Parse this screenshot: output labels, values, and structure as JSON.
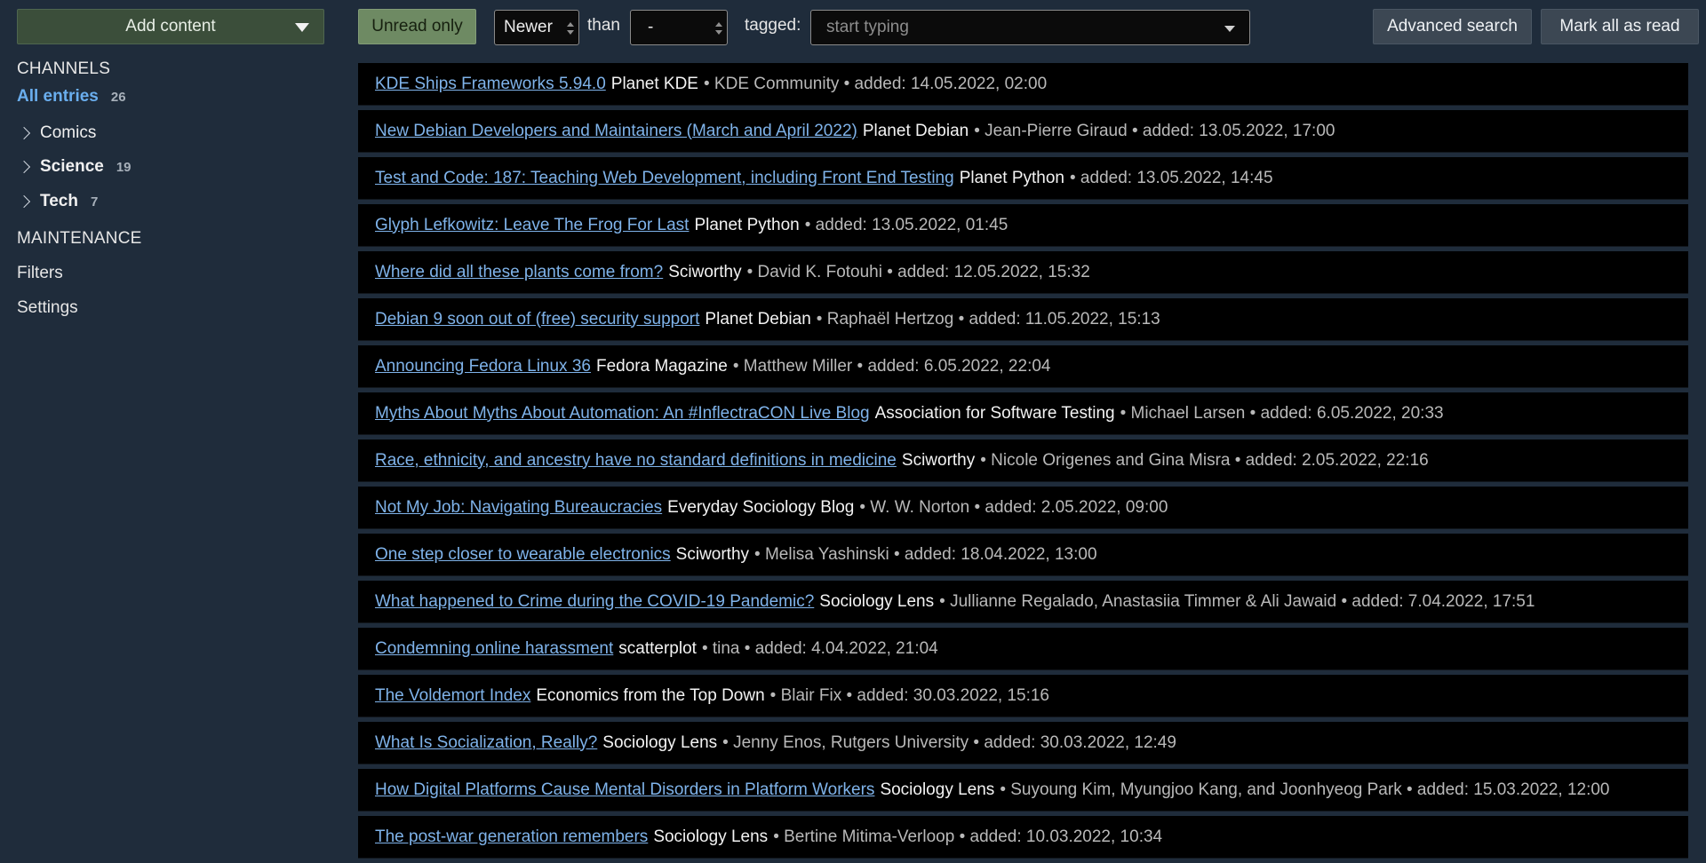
{
  "sidebar": {
    "add_content_label": "Add content",
    "channels_title": "CHANNELS",
    "all_entries": {
      "label": "All entries",
      "count": "26"
    },
    "tags": [
      {
        "label": "Comics",
        "count": "",
        "bold": false
      },
      {
        "label": "Science",
        "count": "19",
        "bold": true
      },
      {
        "label": "Tech",
        "count": "7",
        "bold": true
      }
    ],
    "maintenance_title": "MAINTENANCE",
    "filters_label": "Filters",
    "settings_label": "Settings"
  },
  "toolbar": {
    "unread_only_label": "Unread only",
    "newer_select_value": "Newer",
    "than_label": "than",
    "date_select_value": "-",
    "tagged_label": "tagged:",
    "tag_input_placeholder": "start typing",
    "advanced_search_label": "Advanced search",
    "mark_all_read_label": "Mark all as read"
  },
  "entries": [
    {
      "title": "KDE Ships Frameworks 5.94.0",
      "feed": "Planet KDE",
      "meta": "• KDE Community • added: 14.05.2022, 02:00"
    },
    {
      "title": "New Debian Developers and Maintainers (March and April 2022)",
      "feed": "Planet Debian",
      "meta": "• Jean-Pierre Giraud • added: 13.05.2022, 17:00"
    },
    {
      "title": "Test and Code: 187: Teaching Web Development, including Front End Testing",
      "feed": "Planet Python",
      "meta": "• added: 13.05.2022, 14:45"
    },
    {
      "title": "Glyph Lefkowitz: Leave The Frog For Last",
      "feed": "Planet Python",
      "meta": "• added: 13.05.2022, 01:45"
    },
    {
      "title": "Where did all these plants come from?",
      "feed": "Sciworthy",
      "meta": "• David K. Fotouhi • added: 12.05.2022, 15:32"
    },
    {
      "title": "Debian 9 soon out of (free) security support",
      "feed": "Planet Debian",
      "meta": "• Raphaël Hertzog • added: 11.05.2022, 15:13"
    },
    {
      "title": "Announcing Fedora Linux 36",
      "feed": "Fedora Magazine",
      "meta": "• Matthew Miller • added: 6.05.2022, 22:04"
    },
    {
      "title": "Myths About Myths About Automation: An #InflectraCON Live Blog",
      "feed": "Association for Software Testing",
      "meta": "• Michael Larsen • added: 6.05.2022, 20:33"
    },
    {
      "title": "Race, ethnicity, and ancestry have no standard definitions in medicine",
      "feed": "Sciworthy",
      "meta": "• Nicole Origenes and Gina Misra • added: 2.05.2022, 22:16"
    },
    {
      "title": "Not My Job: Navigating Bureaucracies",
      "feed": "Everyday Sociology Blog",
      "meta": "• W. W. Norton • added: 2.05.2022, 09:00"
    },
    {
      "title": "One step closer to wearable electronics",
      "feed": "Sciworthy",
      "meta": "• Melisa Yashinski • added: 18.04.2022, 13:00"
    },
    {
      "title": "What happened to Crime during the COVID-19 Pandemic?",
      "feed": "Sociology Lens",
      "meta": "• Jullianne Regalado, Anastasiia Timmer & Ali Jawaid • added: 7.04.2022, 17:51"
    },
    {
      "title": "Condemning online harassment",
      "feed": "scatterplot",
      "meta": "• tina • added: 4.04.2022, 21:04"
    },
    {
      "title": "The Voldemort Index",
      "feed": "Economics from the Top Down",
      "meta": "• Blair Fix • added: 30.03.2022, 15:16"
    },
    {
      "title": "What Is Socialization, Really?",
      "feed": "Sociology Lens",
      "meta": "• Jenny Enos, Rutgers University • added: 30.03.2022, 12:49"
    },
    {
      "title": "How Digital Platforms Cause Mental Disorders in Platform Workers",
      "feed": "Sociology Lens",
      "meta": "• Suyoung Kim, Myungjoo Kang, and Joonhyeog Park • added: 15.03.2022, 12:00"
    },
    {
      "title": "The post-war generation remembers",
      "feed": "Sociology Lens",
      "meta": "• Bertine Mitima-Verloop • added: 10.03.2022, 10:34"
    }
  ]
}
